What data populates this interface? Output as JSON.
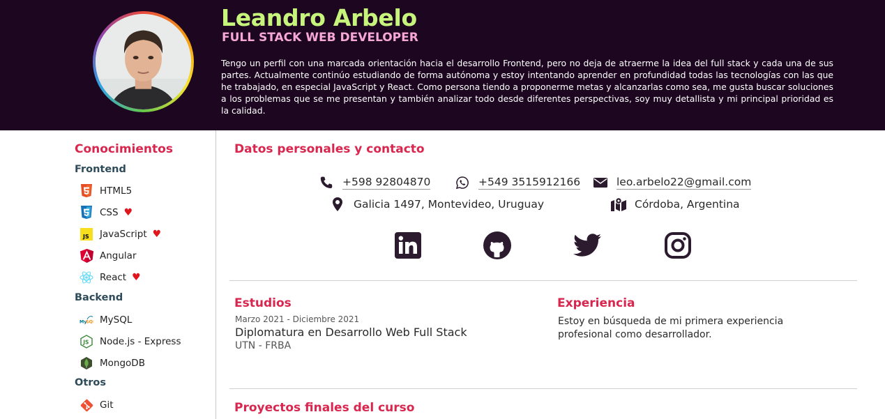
{
  "header": {
    "name": "Leandro Arbelo",
    "role": "FULL STACK WEB DEVELOPER",
    "bio": "Tengo un perfil con una marcada orientación hacia el desarrollo Frontend, pero no deja de atraerme la idea del full stack y cada una de sus partes. Actualmente continúo estudiando de forma autónoma y estoy intentando aprender en profundidad todas las tecnologías con las que he trabajado, en especial JavaScript y React. Como persona tiendo a proponerme metas y alcanzarlas como sea, me gusta buscar soluciones a los problemas que se me presentan y también analizar todo desde diferentes perspectivas, soy muy detallista y mi principal prioridad es la calidad.",
    "colors": {
      "background": "#1d0620",
      "name": "#c7f57c",
      "role": "#f6a7d6"
    }
  },
  "sidebar": {
    "title": "Conocimientos",
    "categories": [
      {
        "label": "Frontend"
      },
      {
        "label": "Backend"
      },
      {
        "label": "Otros"
      }
    ],
    "skills": [
      {
        "label": "HTML5",
        "icon": "html5-icon",
        "favorite": false
      },
      {
        "label": "CSS",
        "icon": "css3-icon",
        "favorite": true
      },
      {
        "label": "JavaScript",
        "icon": "javascript-icon",
        "favorite": true
      },
      {
        "label": "Angular",
        "icon": "angular-icon",
        "favorite": false
      },
      {
        "label": "React",
        "icon": "react-icon",
        "favorite": true
      },
      {
        "label": "MySQL",
        "icon": "mysql-icon",
        "favorite": false
      },
      {
        "label": "Node.js - Express",
        "icon": "nodejs-icon",
        "favorite": false
      },
      {
        "label": "MongoDB",
        "icon": "mongodb-icon",
        "favorite": false
      },
      {
        "label": "Git",
        "icon": "git-icon",
        "favorite": false
      }
    ]
  },
  "contact": {
    "title": "Datos personales y contacto",
    "phone": "+598 92804870",
    "whatsapp": "+549 3515912166",
    "email": "leo.arbelo22@gmail.com",
    "address": "Galicia 1497, Montevideo, Uruguay",
    "city": "Córdoba, Argentina",
    "social": [
      "linkedin-icon",
      "github-icon",
      "twitter-icon",
      "instagram-icon"
    ]
  },
  "studies": {
    "title": "Estudios",
    "date": "Marzo 2021 - Diciembre 2021",
    "degree": "Diplomatura en Desarrollo Web Full Stack",
    "institution": "UTN - FRBA"
  },
  "experience": {
    "title": "Experiencia",
    "text": "Estoy en búsqueda de mi primera experiencia profesional como desarrollador."
  },
  "projects": {
    "title": "Proyectos finales del curso"
  },
  "accent_color": "#d8264e"
}
